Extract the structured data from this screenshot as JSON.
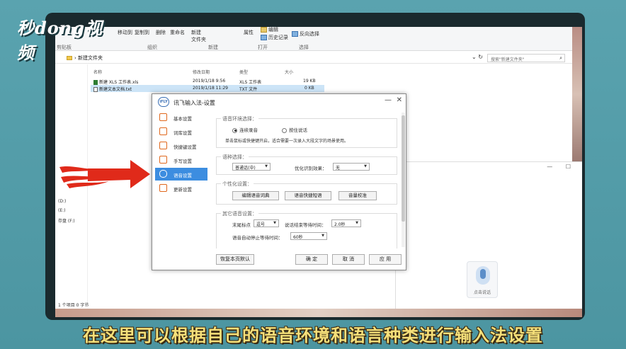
{
  "watermark": {
    "logo_text": "秒dong视频"
  },
  "explorer": {
    "ribbon": {
      "groups": [
        {
          "label": "剪贴板"
        },
        {
          "label": "组织"
        },
        {
          "label": "新建"
        },
        {
          "label": "打开"
        },
        {
          "label": "选择"
        }
      ],
      "buttons": {
        "move_to": "移动到",
        "copy_to": "复制到",
        "delete": "删除",
        "rename": "重命名",
        "new_folder_1": "新建",
        "new_folder_2": "文件夹",
        "properties": "属性",
        "edit": "编辑",
        "history": "历史记录",
        "invert_select": "反向选择"
      }
    },
    "address": {
      "path": "新建文件夹",
      "search_placeholder": "搜索\"新建文件夹\""
    },
    "columns": {
      "name": "名称",
      "date": "修改日期",
      "type": "类型",
      "size": "大小"
    },
    "files": [
      {
        "name": "新建 XLS 工作表.xls",
        "date": "2019/1/18 9:56",
        "type": "XLS 工作表",
        "size": "19 KB"
      },
      {
        "name": "新建文本文档.txt",
        "date": "2019/1/18 11:29",
        "type": "TXT 文件",
        "size": "0 KB"
      }
    ],
    "drives": [
      "(D:)",
      "(E:)",
      "存盘 (F:)"
    ],
    "status": "1 个项目  0 字节"
  },
  "ime_bar": {
    "mic_label": "点击说话"
  },
  "dialog": {
    "logo": "iFLY",
    "title": "讯飞输入法-设置",
    "menu": [
      {
        "label": "基本设置",
        "active": false
      },
      {
        "label": "词库设置",
        "active": false
      },
      {
        "label": "快捷键设置",
        "active": false
      },
      {
        "label": "手写设置",
        "active": false
      },
      {
        "label": "语音设置",
        "active": true
      },
      {
        "label": "更新设置",
        "active": false
      }
    ],
    "voice_env": {
      "title": "语音环境选择：",
      "option_continuous": "连续录音",
      "option_hold": "按住说话",
      "selected": "连续录音",
      "hint": "单击鼠标或快捷键开启，适合需要一次录入大段文字的场景使用。"
    },
    "language": {
      "title": "语种选择：",
      "value": "普通话(中)",
      "optimize_label": "优化识别效果：",
      "optimize_value": "无"
    },
    "personal": {
      "title": "个性化设置：",
      "btn_dict": "编辑语音词典",
      "btn_shortcut": "语音快捷短语",
      "btn_calibrate": "音量校准"
    },
    "other": {
      "title": "其它语音设置：",
      "punct_label": "末尾标点",
      "punct_value": "逗号",
      "wait_label": "说话结束等待时间：",
      "wait_value": "2.0秒",
      "auto_stop_label": "语音自动停止等待时间：",
      "auto_stop_value": "60秒"
    },
    "footer": {
      "restore": "恢复本页默认",
      "ok": "确 定",
      "cancel": "取 消",
      "apply": "应 用"
    }
  },
  "subtitle": "在这里可以根据自己的语音环境和语言种类进行输入法设置",
  "colors": {
    "accent": "#3c8de0",
    "arrow": "#e02a1a",
    "subtitle": "#f5e07a"
  }
}
